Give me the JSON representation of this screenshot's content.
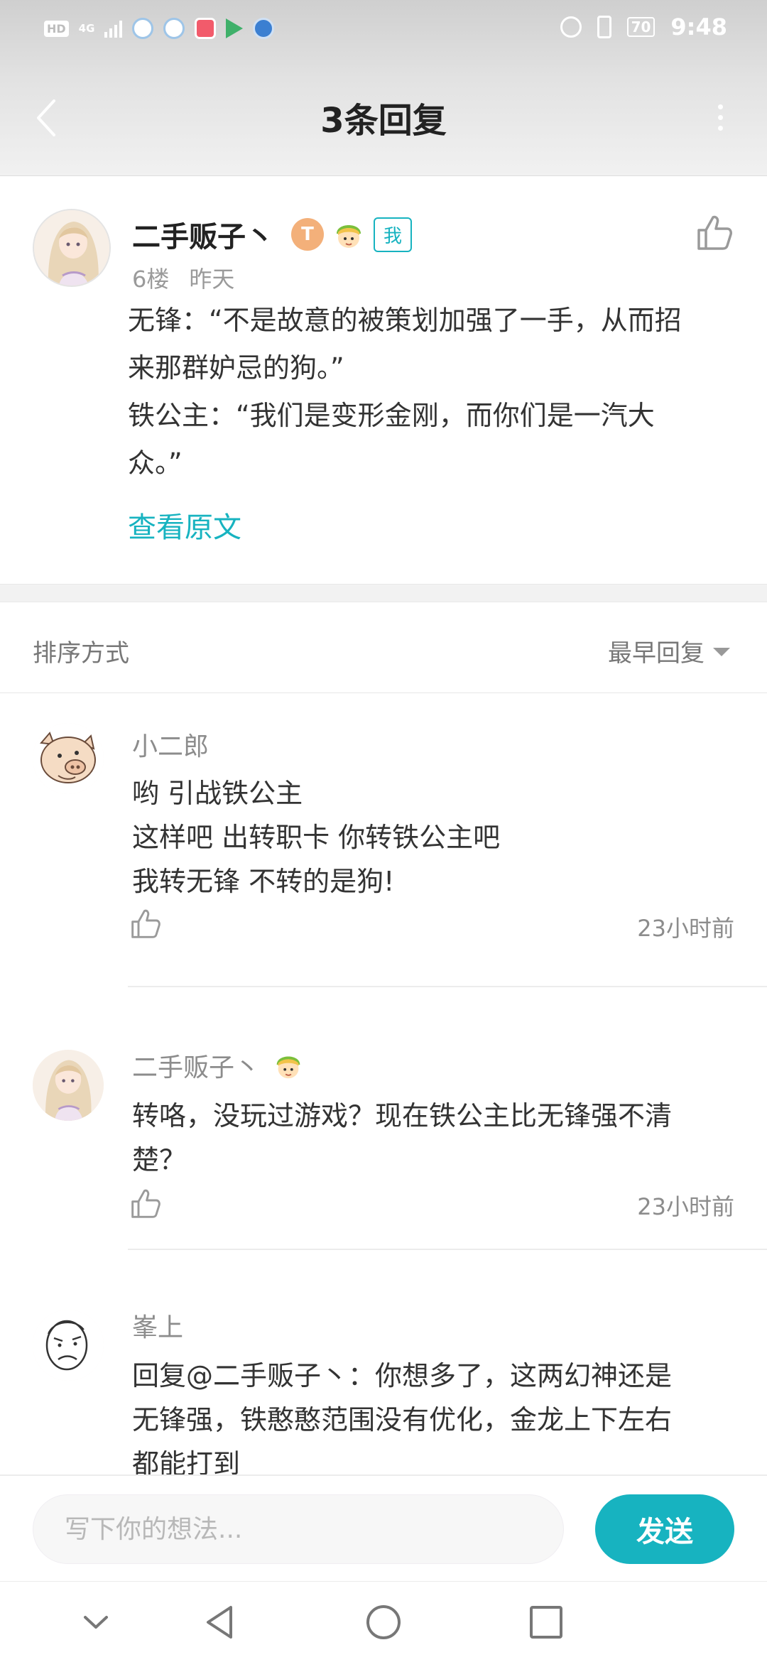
{
  "status_bar": {
    "hd": "HD",
    "network": "4G",
    "battery": "70",
    "time": "9:48"
  },
  "header": {
    "title": "3条回复",
    "back_icon": "chevron-left-icon",
    "more_icon": "more-vertical-icon"
  },
  "post": {
    "author": "二手贩子丶",
    "level_badge": "T",
    "me_badge": "我",
    "floor": "6楼",
    "time": "昨天",
    "lines": [
      "无锋：“不是故意的被策划加强了一手，从而招",
      "来那群妒忌的狗。”",
      "铁公主：“我们是变形金刚，而你们是一汽大",
      "众。”"
    ],
    "view_original": "查看原文"
  },
  "sort": {
    "label": "排序方式",
    "value": "最早回复"
  },
  "replies": [
    {
      "name": "小二郎",
      "avatar": "pig-avatar",
      "lines": [
        "哟 引战铁公主",
        "这样吧 出转职卡 你转铁公主吧",
        "我转无锋 不转的是狗!"
      ],
      "time": "23小时前"
    },
    {
      "name": "二手贩子丶",
      "avatar": "anime-girl-avatar",
      "lines": [
        "转咯，没玩过游戏？现在铁公主比无锋强不清",
        "楚？"
      ],
      "time": "23小时前"
    },
    {
      "name": "峯上",
      "avatar": "sketch-face-avatar",
      "lines": [
        "回复@二手贩子丶：你想多了，这两幻神还是",
        "无锋强，铁憨憨范围没有优化，金龙上下左右",
        "都能打到"
      ]
    }
  ],
  "composer": {
    "placeholder": "写下你的想法...",
    "send": "发送"
  },
  "colors": {
    "accent": "#17b3c0",
    "muted_text": "#8c8c8c",
    "body_text": "#333333"
  }
}
